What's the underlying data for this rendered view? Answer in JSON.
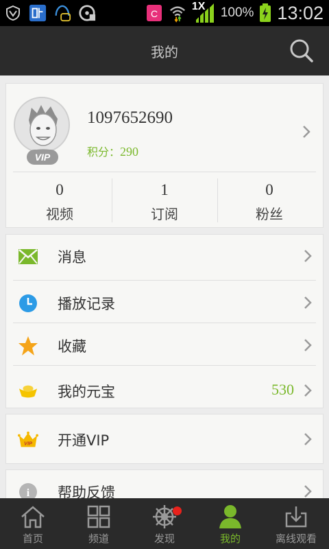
{
  "status_bar": {
    "network_type": "1X",
    "battery": "100%",
    "time": "13:02",
    "icons": [
      "shield-icon",
      "tieba-icon",
      "notification-app-icon",
      "storage-icon",
      "app-c-icon",
      "wifi-icon",
      "signal-icon",
      "battery-icon"
    ]
  },
  "header": {
    "title": "我的"
  },
  "profile": {
    "vip_badge": "VIP",
    "username": "1097652690",
    "points_label": "积分：",
    "points_value": "290",
    "stats": [
      {
        "value": "0",
        "label": "视频"
      },
      {
        "value": "1",
        "label": "订阅"
      },
      {
        "value": "0",
        "label": "粉丝"
      }
    ]
  },
  "menu": {
    "items": [
      {
        "icon": "envelope-icon",
        "label": "消息"
      },
      {
        "icon": "clock-icon",
        "label": "播放记录"
      },
      {
        "icon": "star-icon",
        "label": "收藏"
      },
      {
        "icon": "ingot-icon",
        "label": "我的元宝",
        "value": "530"
      }
    ]
  },
  "vip": {
    "icon": "crown-icon",
    "crown_text": "VIP",
    "label": "开通VIP"
  },
  "help": {
    "icon": "info-icon",
    "icon_text": "i",
    "label": "帮助反馈"
  },
  "bottom_nav": {
    "items": [
      {
        "icon": "home-icon",
        "label": "首页"
      },
      {
        "icon": "grid-icon",
        "label": "频道"
      },
      {
        "icon": "compass-wheel-icon",
        "label": "发现"
      },
      {
        "icon": "person-icon",
        "label": "我的"
      },
      {
        "icon": "download-icon",
        "label": "离线观看"
      }
    ]
  },
  "colors": {
    "accent_green": "#7ab82b",
    "clock_blue": "#2c9be6",
    "star_orange": "#f5a418",
    "ingot_gold": "#f5c400",
    "badge_red": "#e8221c",
    "header_bg": "#2b2b2b",
    "card_bg": "#f7f7f5"
  }
}
